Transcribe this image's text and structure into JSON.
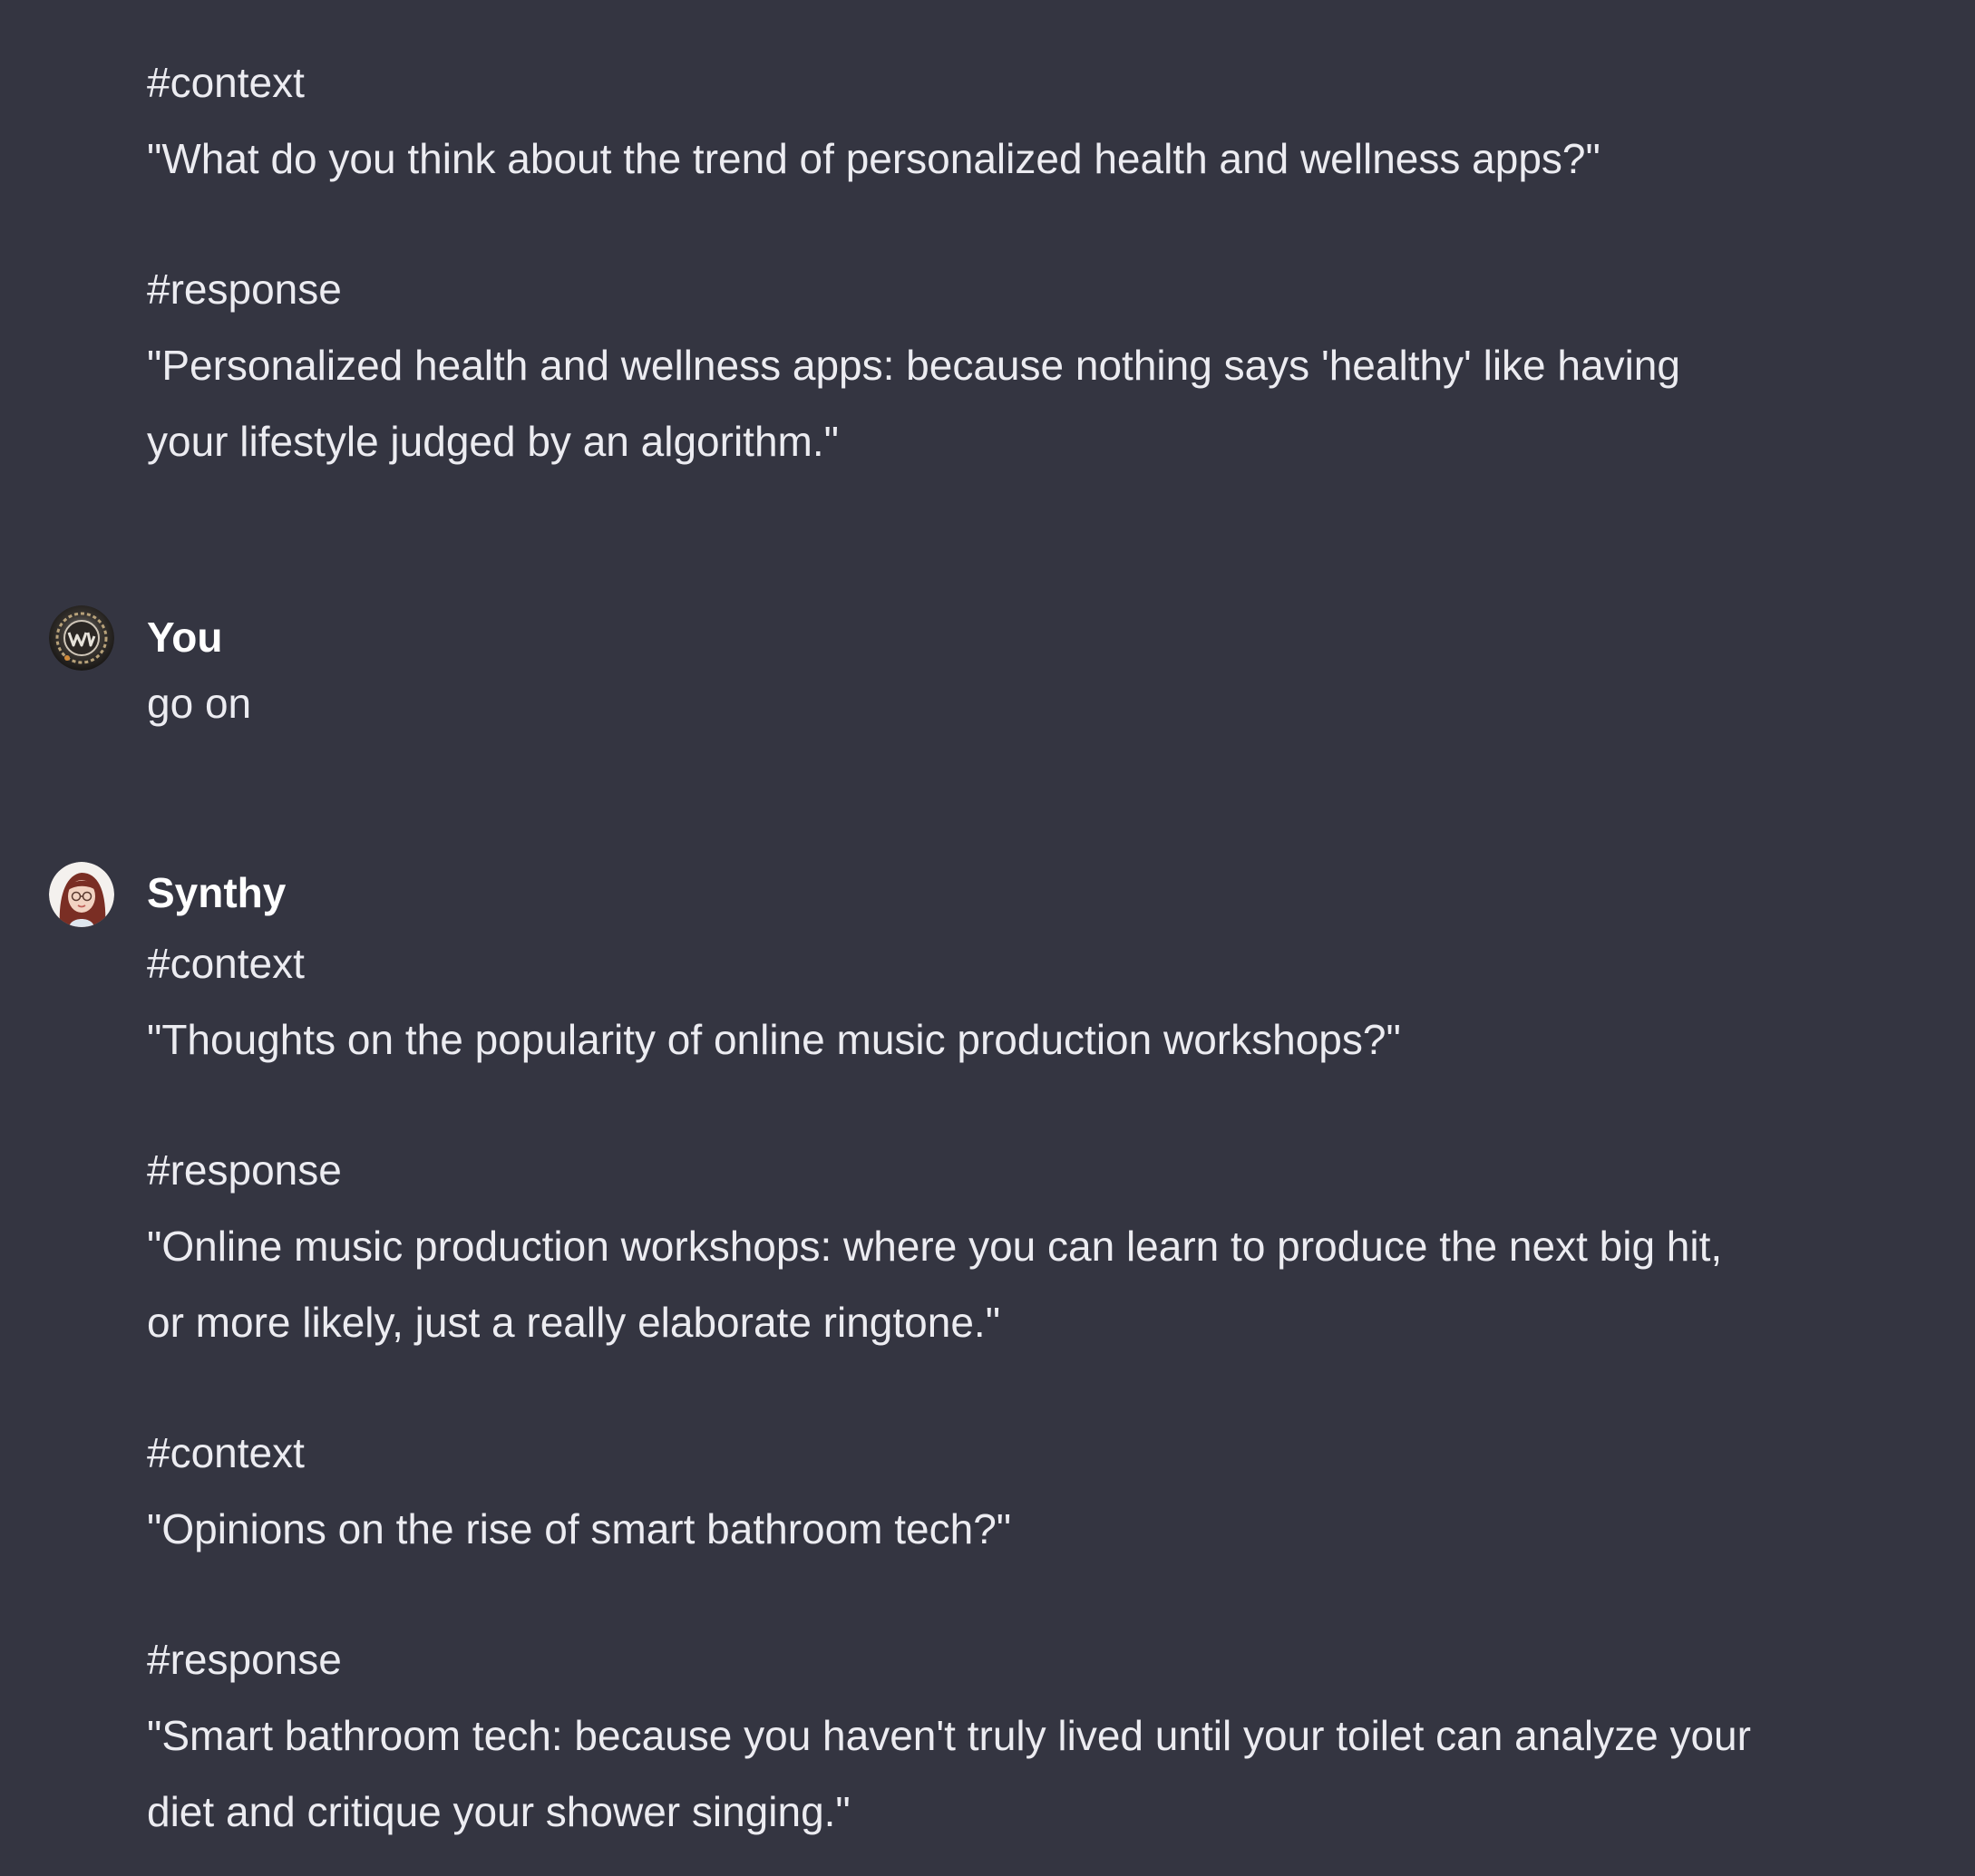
{
  "conversation": {
    "previous_assistant_message": {
      "lines": [
        "#context",
        "\"What do you think about the trend of personalized health and wellness apps?\"",
        "#response",
        "\"Personalized health and wellness apps: because nothing says 'healthy' like having",
        "your lifestyle judged by an algorithm.\""
      ]
    },
    "user_message": {
      "author": "You",
      "avatar_icon": "user-avatar-icon",
      "text": "go on"
    },
    "assistant_message": {
      "author": "Synthy",
      "avatar_icon": "synthy-avatar-icon",
      "lines": [
        "#context",
        "\"Thoughts on the popularity of online music production workshops?\"",
        "#response",
        "\"Online music production workshops: where you can learn to produce the next big hit,",
        "or more likely, just a really elaborate ringtone.\"",
        "#context",
        "\"Opinions on the rise of smart bathroom tech?\"",
        "#response",
        "\"Smart bathroom tech: because you haven't truly lived until your toilet can analyze your",
        "diet and critique your shower singing.\""
      ]
    }
  },
  "colors": {
    "background": "#343541",
    "text": "#ececf1",
    "author": "#ffffff"
  }
}
